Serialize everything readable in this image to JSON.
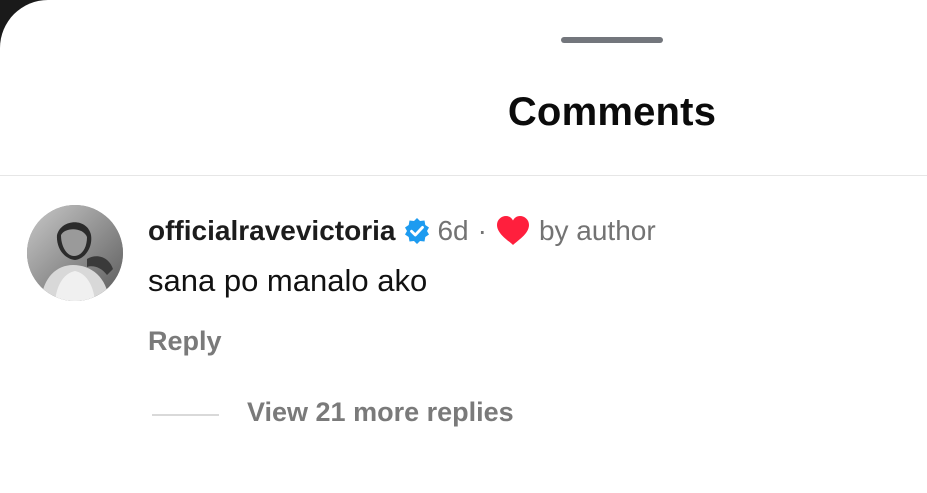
{
  "sheet": {
    "title": "Comments"
  },
  "comment": {
    "username": "officialravevictoria",
    "verified_icon": "verified-badge-icon",
    "time": "6d",
    "separator": "·",
    "heart_icon": "heart-icon",
    "liked_by_label": "by author",
    "text": "sana po manalo ako",
    "reply_label": "Reply",
    "view_replies_label": "View 21 more replies"
  },
  "colors": {
    "verified_blue": "#1d9bf0",
    "heart_red": "#ff1f3d",
    "muted_text": "#737373"
  }
}
